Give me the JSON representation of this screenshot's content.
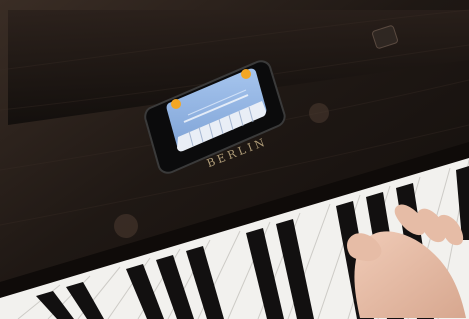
{
  "scene": {
    "piano_brand": "BERLIN"
  },
  "phone_screen": {
    "colors": {
      "sky": "#8fb3e0",
      "keys": "#e9eef6",
      "accent": "#f3a623"
    }
  },
  "colors": {
    "wood": "#1b1512",
    "key_white": "#f2f1ee",
    "key_black": "#121010",
    "skin": "#e2b9a4"
  }
}
